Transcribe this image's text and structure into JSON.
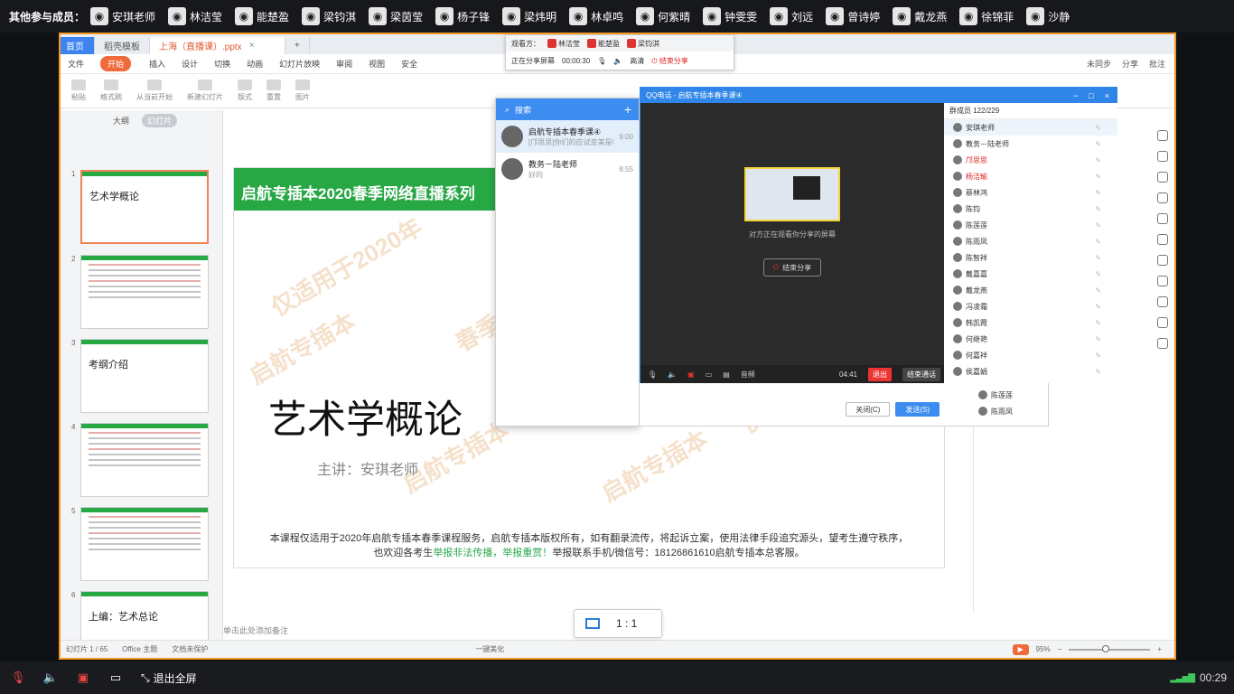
{
  "topbar": {
    "label": "其他参与成员：",
    "members": [
      "安琪老师",
      "林洁莹",
      "能楚盈",
      "梁钧淇",
      "梁茵莹",
      "杨子锋",
      "梁炜明",
      "林卓鸣",
      "何紫晴",
      "钟雯雯",
      "刘远",
      "曾诗婷",
      "戴龙燕",
      "徐锦菲",
      "沙静"
    ]
  },
  "wps": {
    "tabs": [
      "首页",
      "稻壳模板",
      "上海（直播课）.pptx"
    ],
    "menus": [
      "文件",
      "开始",
      "插入",
      "设计",
      "切换",
      "动画",
      "幻灯片放映",
      "审阅",
      "视图",
      "安全"
    ],
    "menu_right": [
      "未同步",
      "分享",
      "批注"
    ],
    "ribbon": [
      "粘贴",
      "格式刷",
      "从当前开始",
      "新建幻灯片",
      "版式",
      "重置",
      "图片"
    ],
    "thumb_tabs": [
      "大纲",
      "幻灯片"
    ],
    "thumbs": [
      {
        "num": "1",
        "title": "艺术学概论"
      },
      {
        "num": "2",
        "title": ""
      },
      {
        "num": "3",
        "title": "考纲介绍"
      },
      {
        "num": "4",
        "title": ""
      },
      {
        "num": "5",
        "title": ""
      },
      {
        "num": "6",
        "title": "上编：艺术总论"
      }
    ],
    "slide": {
      "banner": "启航专插本2020春季网络直播系列",
      "title": "艺术学概论",
      "lecturer": "主讲：安琪老师",
      "notice1": "本课程仅适用于2020年启航专插本春季课程服务，启航专插本版权所有，如有翻录流传，将起诉立案，使用法律手段追究源头，望考生遵守秩序，",
      "notice2_a": "也欢迎各考生",
      "notice2_b": "举报非法传播，举报重赏！",
      "notice2_c": "举报联系手机/微信号：18126861610启航专插本总客服。",
      "watermarks": [
        "启航专插本",
        "仅适用于2020年",
        "启航专插本",
        "春季课程",
        "启航专插本",
        "仅适用于2020年"
      ]
    },
    "notes_placeholder": "单击此处添加备注",
    "status": {
      "slide": "幻灯片 1 / 65",
      "theme": "Office 主题",
      "protect": "文档未保护",
      "beautify": "一键美化",
      "zoom": "95%"
    },
    "zoom_fraction": 0.45
  },
  "sharebar": {
    "viewers_label": "观看方：",
    "viewers": [
      "林洁莹",
      "能楚盈",
      "梁钧淇"
    ],
    "sharing_label": "正在分享屏幕",
    "time": "00:00:30",
    "quality": "高清",
    "end": "结束分享"
  },
  "ratio": {
    "label": "1 : 1"
  },
  "qqlist": {
    "search": "搜索",
    "contacts": [
      {
        "name": "启航专插本春季课④",
        "sub": "[邝思思]你们的应试变美是吗",
        "time": "9:00"
      },
      {
        "name": "教务－陆老师",
        "sub": "好的",
        "time": "8:55"
      }
    ]
  },
  "groupchat": {
    "close": "关闭(C)",
    "send": "发送(S)"
  },
  "qqcall": {
    "title": "QQ电话 - 启航专插本春季课④",
    "sharing_msg": "对方正在观看你分享的屏幕",
    "stop": "结束分享",
    "time": "04:41",
    "quit": "退出",
    "end": "结束通话",
    "ctrl_items": [
      "音频"
    ],
    "members_header": "群成员 122/229",
    "members": [
      {
        "name": "安琪老师",
        "red": false
      },
      {
        "name": "教务－陆老师",
        "red": false
      },
      {
        "name": "邝思思",
        "red": true
      },
      {
        "name": "杨洁瑜",
        "red": true
      },
      {
        "name": "蔡林鸿",
        "red": false
      },
      {
        "name": "陈钧",
        "red": false
      },
      {
        "name": "陈莲莲",
        "red": false
      },
      {
        "name": "陈雨凤",
        "red": false
      },
      {
        "name": "陈智祥",
        "red": false
      },
      {
        "name": "戴嘉嘉",
        "red": false
      },
      {
        "name": "戴龙燕",
        "red": false
      },
      {
        "name": "冯凌霜",
        "red": false
      },
      {
        "name": "韩凯霞",
        "red": false
      },
      {
        "name": "何继艳",
        "red": false
      },
      {
        "name": "何嘉祥",
        "red": false
      },
      {
        "name": "侯嘉娟",
        "red": false
      }
    ],
    "extra_members": [
      "陈莲莲",
      "陈雨凤"
    ]
  },
  "bottombar": {
    "exit": "退出全屏",
    "time": "00:29"
  }
}
